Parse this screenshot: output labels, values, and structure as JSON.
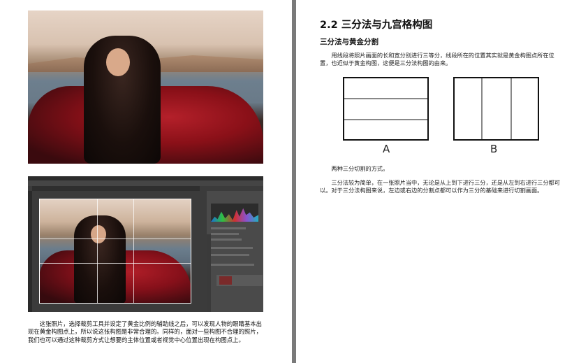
{
  "left_page": {
    "caption": "这张照片，选择裁剪工具并设定了黄金比例的辅助线之后，可以发现人物的眼睛基本出现在黄金构图点上，所以说这张构图是非常合理的。同样的，面对一些构图不合理的照片，我们也可以通过这种裁剪方式让想要的主体位置或者视觉中心位置出现在构图点上。"
  },
  "right_page": {
    "section_title": "2.2 三分法与九宫格构图",
    "subsection_title": "三分法与黄金分割",
    "intro_paragraph": "用线段将照片画面的长和宽分别进行三等分，线段所在的位置其实就是黄金构图点所在位置，也近似于黄金构图，这便是三分法构图的由来。",
    "diagram_a_label": "A",
    "diagram_b_label": "B",
    "diagram_caption": "两种三分切割的方式。",
    "body_paragraph": "三分法较为简单，在一张照片当中，无论是从上到下进行三分，还是从左到右进行三分都可以。对于三分法构图来说，左边或右边的分割点都可以作为三分的基础来进行切割画面。"
  }
}
